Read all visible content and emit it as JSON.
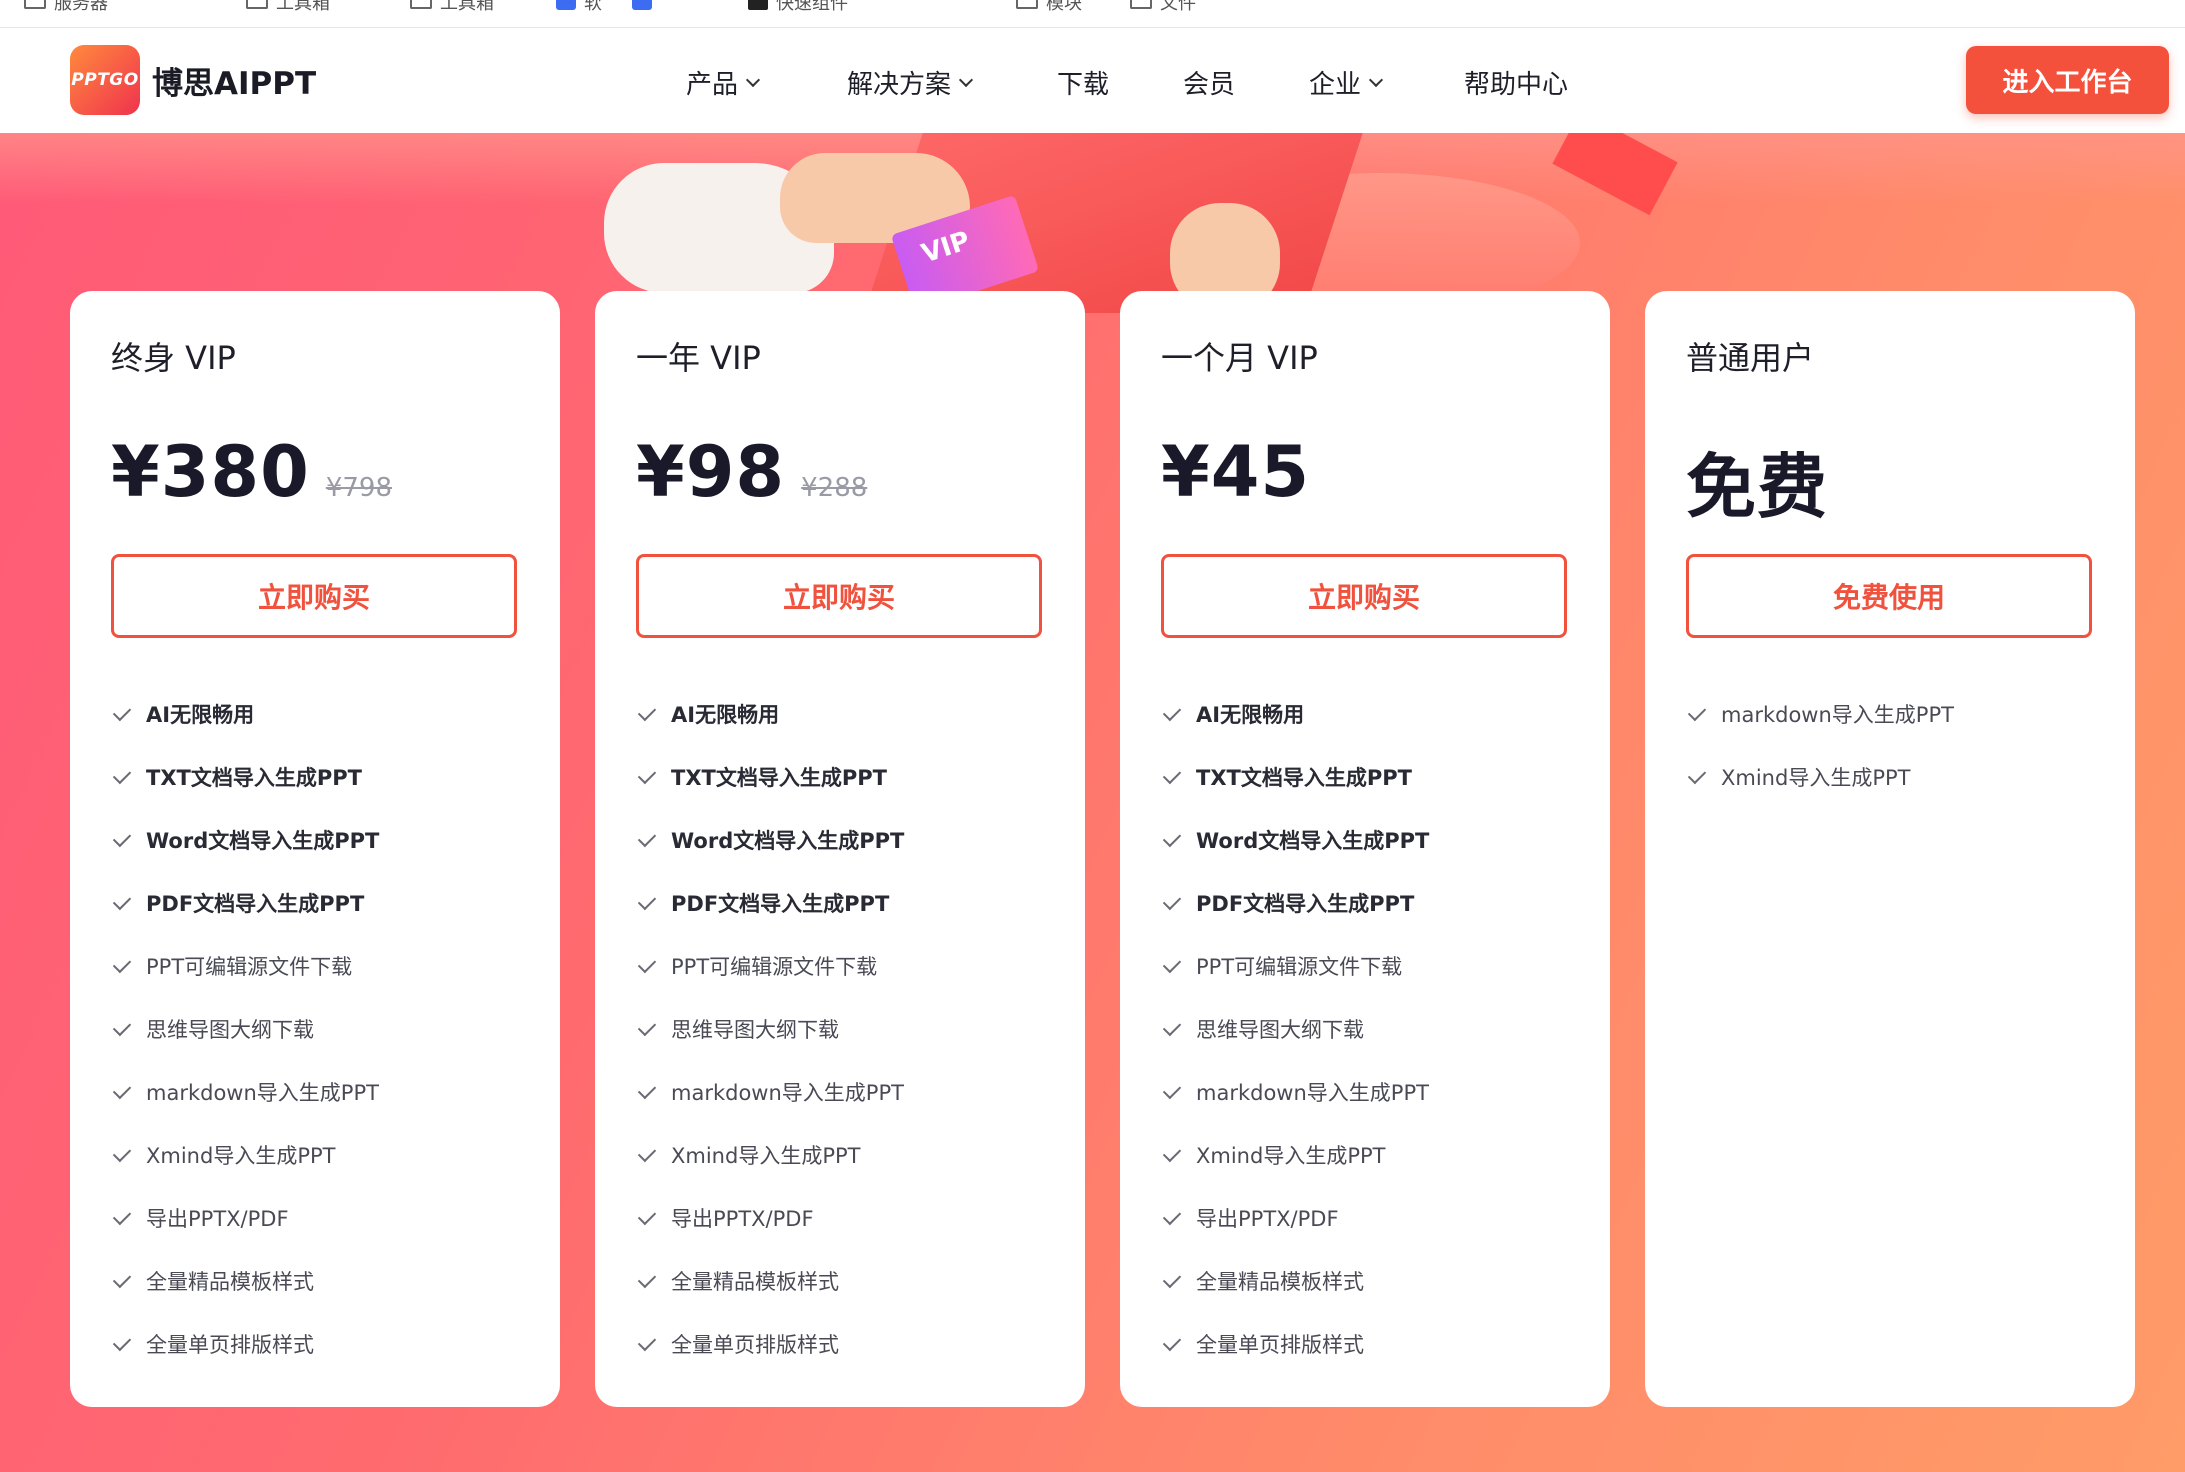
{
  "bookmarks": [
    {
      "label": "服务器",
      "icon": "folder-icon"
    },
    {
      "label": "工具箱",
      "icon": "folder-icon"
    },
    {
      "label": "工具箱",
      "icon": "folder-icon"
    },
    {
      "label": "软",
      "icon": "app-icon"
    },
    {
      "label": "",
      "icon": "app-icon"
    },
    {
      "label": "快速组件",
      "icon": "app-icon"
    },
    {
      "label": "模块",
      "icon": "folder-icon"
    },
    {
      "label": "文件",
      "icon": "folder-icon"
    }
  ],
  "header": {
    "logo_mark": "PPTGO",
    "logo_text": "博思AIPPT",
    "nav": [
      {
        "label": "产品",
        "dropdown": true
      },
      {
        "label": "解决方案",
        "dropdown": true
      },
      {
        "label": "下载",
        "dropdown": false
      },
      {
        "label": "会员",
        "dropdown": false
      },
      {
        "label": "企业",
        "dropdown": true
      },
      {
        "label": "帮助中心",
        "dropdown": false
      }
    ],
    "cta": "进入工作台"
  },
  "hero": {
    "ticket_text": "VIP"
  },
  "colors": {
    "accent": "#f4513d",
    "card_bg": "#ffffff",
    "text_dark": "#191929"
  },
  "plans": [
    {
      "name": "终身 VIP",
      "price": "¥380",
      "original_price": "¥798",
      "button": "立即购买",
      "features": [
        {
          "text": "AI无限畅用",
          "bold": true
        },
        {
          "text": "TXT文档导入生成PPT",
          "bold": true
        },
        {
          "text": "Word文档导入生成PPT",
          "bold": true
        },
        {
          "text": "PDF文档导入生成PPT",
          "bold": true
        },
        {
          "text": "PPT可编辑源文件下载",
          "bold": false
        },
        {
          "text": "思维导图大纲下载",
          "bold": false
        },
        {
          "text": "markdown导入生成PPT",
          "bold": false
        },
        {
          "text": "Xmind导入生成PPT",
          "bold": false
        },
        {
          "text": "导出PPTX/PDF",
          "bold": false
        },
        {
          "text": "全量精品模板样式",
          "bold": false
        },
        {
          "text": "全量单页排版样式",
          "bold": false
        }
      ]
    },
    {
      "name": "一年 VIP",
      "price": "¥98",
      "original_price": "¥288",
      "button": "立即购买",
      "features": [
        {
          "text": "AI无限畅用",
          "bold": true
        },
        {
          "text": "TXT文档导入生成PPT",
          "bold": true
        },
        {
          "text": "Word文档导入生成PPT",
          "bold": true
        },
        {
          "text": "PDF文档导入生成PPT",
          "bold": true
        },
        {
          "text": "PPT可编辑源文件下载",
          "bold": false
        },
        {
          "text": "思维导图大纲下载",
          "bold": false
        },
        {
          "text": "markdown导入生成PPT",
          "bold": false
        },
        {
          "text": "Xmind导入生成PPT",
          "bold": false
        },
        {
          "text": "导出PPTX/PDF",
          "bold": false
        },
        {
          "text": "全量精品模板样式",
          "bold": false
        },
        {
          "text": "全量单页排版样式",
          "bold": false
        }
      ]
    },
    {
      "name": "一个月 VIP",
      "price": "¥45",
      "original_price": "",
      "button": "立即购买",
      "features": [
        {
          "text": "AI无限畅用",
          "bold": true
        },
        {
          "text": "TXT文档导入生成PPT",
          "bold": true
        },
        {
          "text": "Word文档导入生成PPT",
          "bold": true
        },
        {
          "text": "PDF文档导入生成PPT",
          "bold": true
        },
        {
          "text": "PPT可编辑源文件下载",
          "bold": false
        },
        {
          "text": "思维导图大纲下载",
          "bold": false
        },
        {
          "text": "markdown导入生成PPT",
          "bold": false
        },
        {
          "text": "Xmind导入生成PPT",
          "bold": false
        },
        {
          "text": "导出PPTX/PDF",
          "bold": false
        },
        {
          "text": "全量精品模板样式",
          "bold": false
        },
        {
          "text": "全量单页排版样式",
          "bold": false
        }
      ]
    },
    {
      "name": "普通用户",
      "price": "免费",
      "original_price": "",
      "button": "免费使用",
      "features": [
        {
          "text": "markdown导入生成PPT",
          "bold": false
        },
        {
          "text": "Xmind导入生成PPT",
          "bold": false
        }
      ]
    }
  ]
}
